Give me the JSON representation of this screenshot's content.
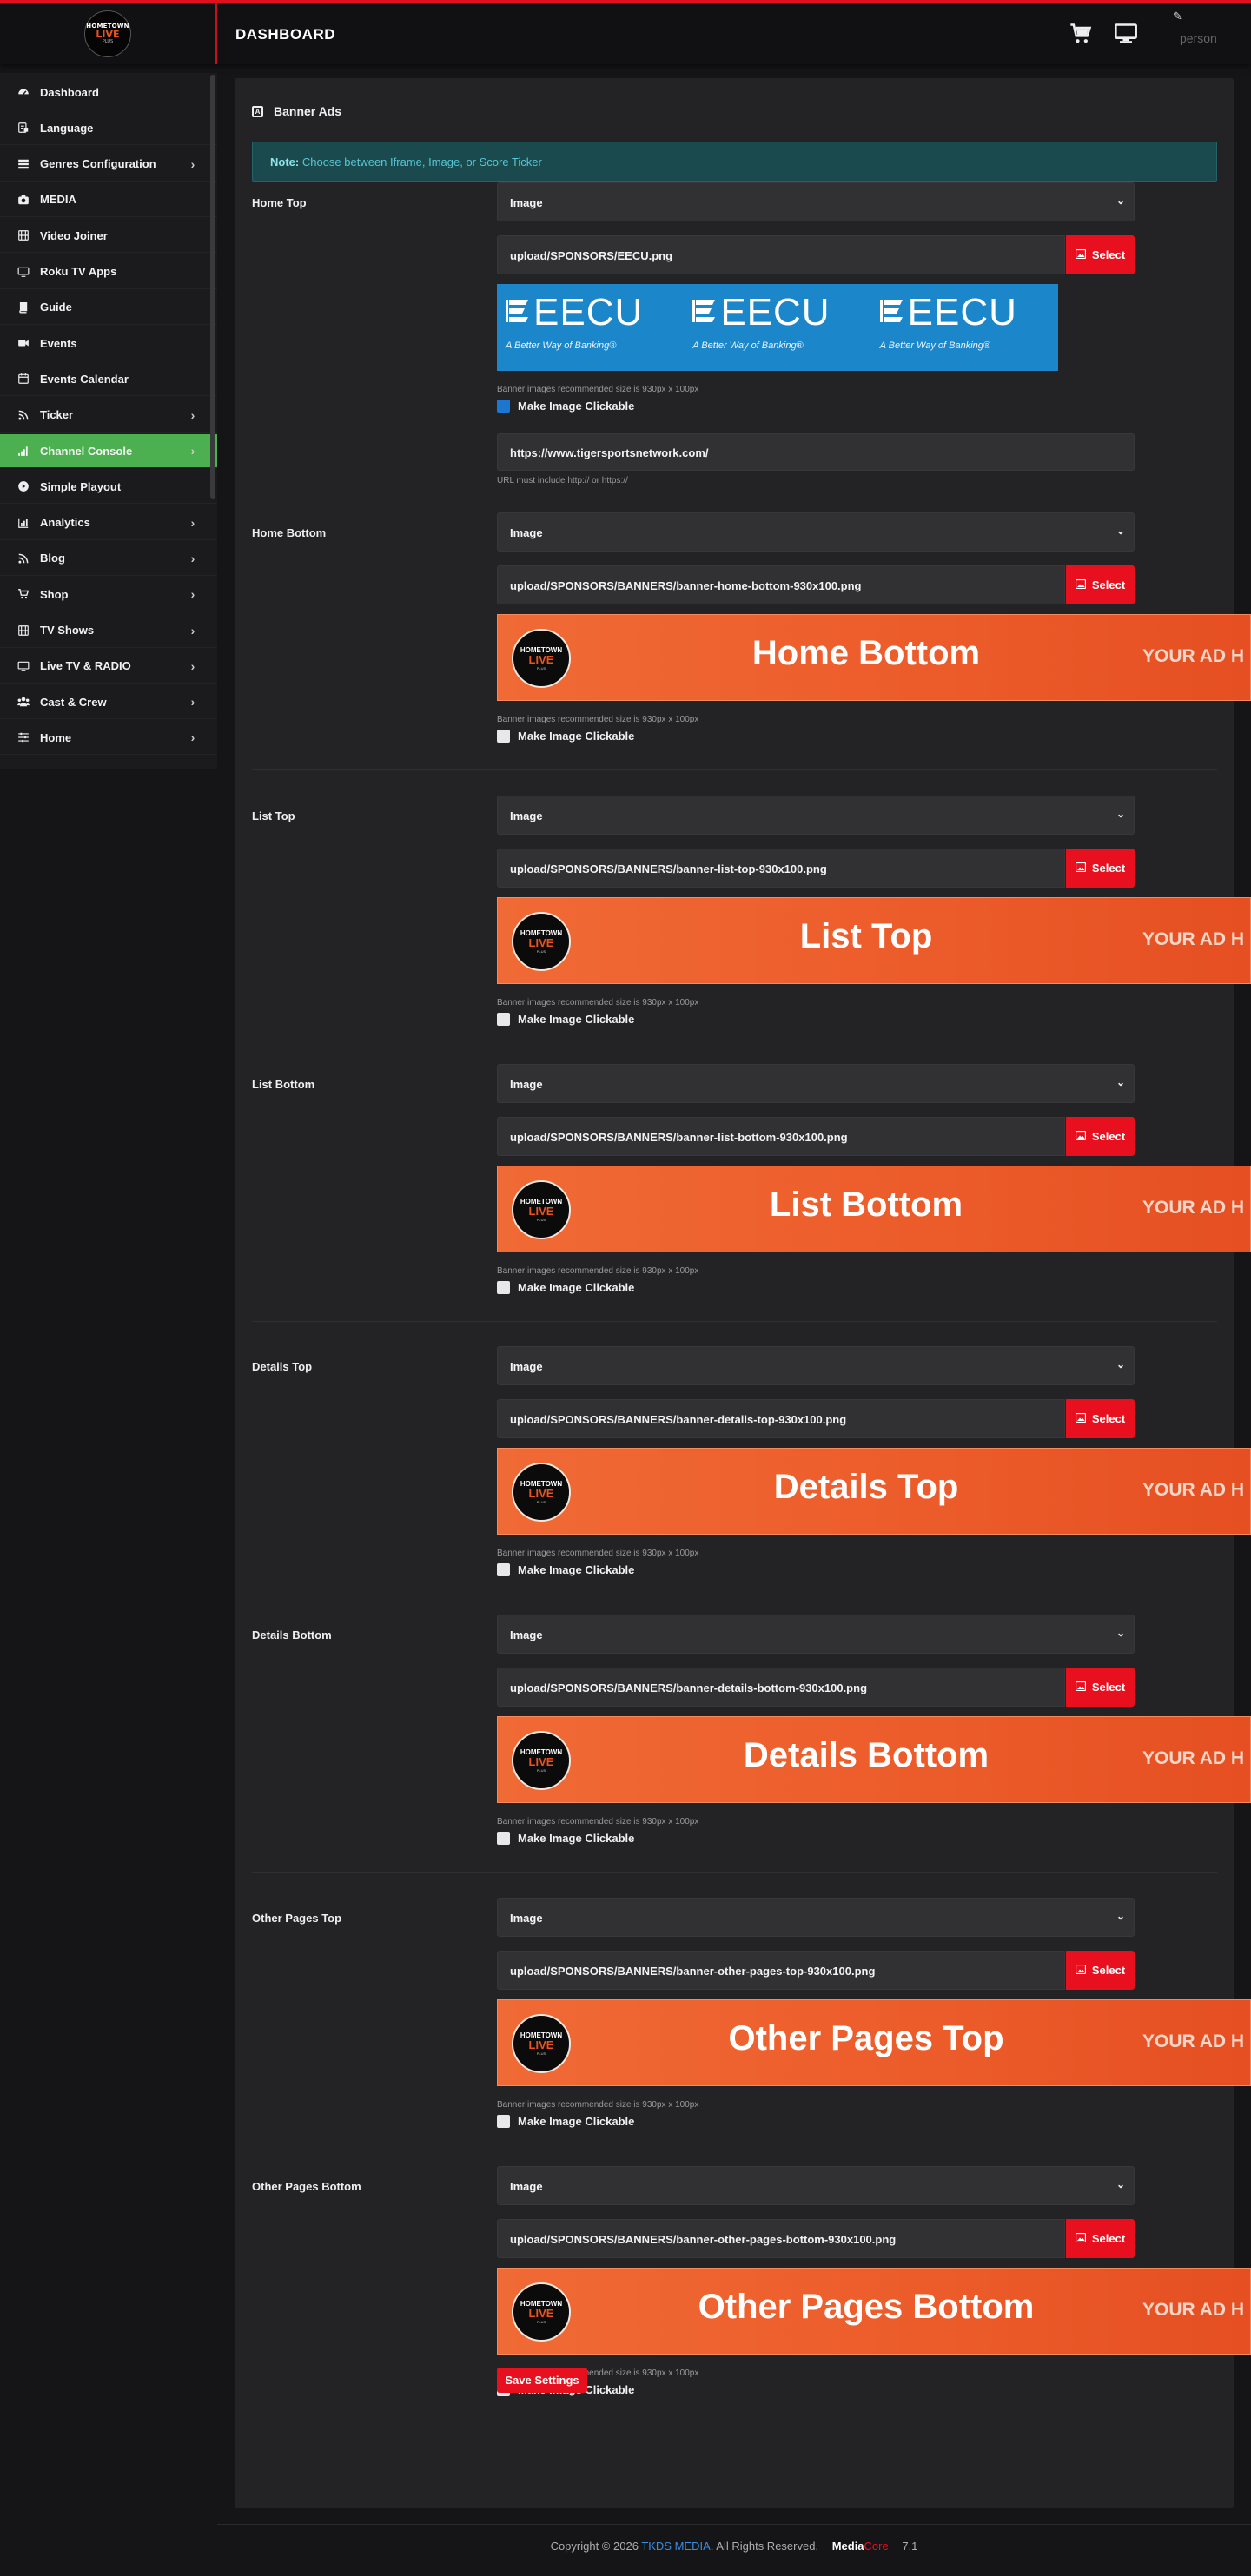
{
  "header": {
    "title": "DASHBOARD",
    "logo": {
      "line1": "HOMETOWN",
      "line2": "LIVE",
      "line3": "PLUS"
    },
    "user_text": "person",
    "icons": [
      "cart-icon",
      "monitor-icon",
      "edit-icon"
    ]
  },
  "sidebar": {
    "items": [
      {
        "label": "Dashboard",
        "icon": "dashboard-icon",
        "chevron": false
      },
      {
        "label": "Language",
        "icon": "language-icon",
        "chevron": false
      },
      {
        "label": "Genres Configuration",
        "icon": "list-icon",
        "chevron": true
      },
      {
        "label": "MEDIA",
        "icon": "camera-icon",
        "chevron": false
      },
      {
        "label": "Video Joiner",
        "icon": "film-icon",
        "chevron": false
      },
      {
        "label": "Roku TV Apps",
        "icon": "tv-icon",
        "chevron": false
      },
      {
        "label": "Guide",
        "icon": "book-icon",
        "chevron": false
      },
      {
        "label": "Events",
        "icon": "video-icon",
        "chevron": false
      },
      {
        "label": "Events Calendar",
        "icon": "calendar-icon",
        "chevron": false
      },
      {
        "label": "Ticker",
        "icon": "rss-icon",
        "chevron": true
      },
      {
        "label": "Channel Console",
        "icon": "signal-icon",
        "chevron": true,
        "active": true
      },
      {
        "label": "Simple Playout",
        "icon": "play-circle-icon",
        "chevron": false
      },
      {
        "label": "Analytics",
        "icon": "chart-icon",
        "chevron": true
      },
      {
        "label": "Blog",
        "icon": "rss-icon",
        "chevron": true
      },
      {
        "label": "Shop",
        "icon": "cart-icon",
        "chevron": true
      },
      {
        "label": "TV Shows",
        "icon": "film-icon",
        "chevron": true
      },
      {
        "label": "Live TV & RADIO",
        "icon": "tv-icon",
        "chevron": true
      },
      {
        "label": "Cast & Crew",
        "icon": "users-icon",
        "chevron": true
      },
      {
        "label": "Home",
        "icon": "sliders-icon",
        "chevron": true
      }
    ]
  },
  "panel": {
    "title": "Banner Ads",
    "note_label": "Note:",
    "note_text": "Choose between Iframe, Image, or Score Ticker",
    "select_button": "Select",
    "hint": "Banner images recommended size is 930px x 100px",
    "clickable_label": "Make Image Clickable",
    "save_button": "Save Settings"
  },
  "banners": [
    {
      "label": "Home Top",
      "type": "Image",
      "file": "upload/SPONSORS/EECU.png",
      "preview": {
        "kind": "eecu",
        "word": "EECU",
        "tagline": "A Better Way of Banking®"
      },
      "clickable": true,
      "url": "https://www.tigersportsnetwork.com/",
      "url_hint": "URL must include http:// or https://"
    },
    {
      "label": "Home Bottom",
      "type": "Image",
      "file": "upload/SPONSORS/BANNERS/banner-home-bottom-930x100.png",
      "preview": {
        "kind": "ad",
        "text": "Home Bottom",
        "side": "YOUR AD H"
      },
      "clickable": false
    },
    {
      "label": "List Top",
      "type": "Image",
      "file": "upload/SPONSORS/BANNERS/banner-list-top-930x100.png",
      "preview": {
        "kind": "ad",
        "text": "List Top",
        "side": "YOUR AD H"
      },
      "clickable": false
    },
    {
      "label": "List Bottom",
      "type": "Image",
      "file": "upload/SPONSORS/BANNERS/banner-list-bottom-930x100.png",
      "preview": {
        "kind": "ad",
        "text": "List Bottom",
        "side": "YOUR AD H"
      },
      "clickable": false
    },
    {
      "label": "Details Top",
      "type": "Image",
      "file": "upload/SPONSORS/BANNERS/banner-details-top-930x100.png",
      "preview": {
        "kind": "ad",
        "text": "Details Top",
        "side": "YOUR AD H"
      },
      "clickable": false
    },
    {
      "label": "Details Bottom",
      "type": "Image",
      "file": "upload/SPONSORS/BANNERS/banner-details-bottom-930x100.png",
      "preview": {
        "kind": "ad",
        "text": "Details Bottom",
        "side": "YOUR AD H"
      },
      "clickable": false
    },
    {
      "label": "Other Pages Top",
      "type": "Image",
      "file": "upload/SPONSORS/BANNERS/banner-other-pages-top-930x100.png",
      "preview": {
        "kind": "ad",
        "text": "Other Pages Top",
        "side": "YOUR AD H"
      },
      "clickable": false
    },
    {
      "label": "Other Pages Bottom",
      "type": "Image",
      "file": "upload/SPONSORS/BANNERS/banner-other-pages-bottom-930x100.png",
      "preview": {
        "kind": "ad",
        "text": "Other Pages Bottom",
        "side": "YOUR AD H"
      },
      "clickable": false
    }
  ],
  "footer": {
    "copyright": "Copyright © 2026",
    "brand": "TKDS MEDIA",
    "rights": ". All Rights Reserved.",
    "product_media": "Media",
    "product_core": "Core",
    "version": "7.1"
  },
  "colors": {
    "accent_red": "#e8101e",
    "active_green": "#4caf50",
    "note_bg": "#1a4a4e",
    "checkbox_on": "#1c77d3",
    "banner_orange": "#ec5b2a",
    "eecu_blue": "#1b86c9"
  }
}
